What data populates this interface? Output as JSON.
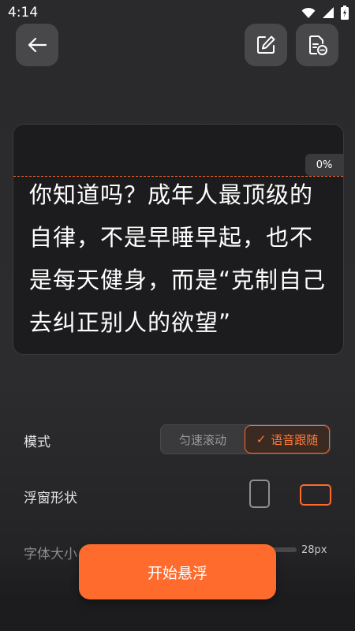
{
  "status_bar": {
    "time": "4:14"
  },
  "preview": {
    "scroll_percent": "0%",
    "script_text": "你知道吗？成年人最顶级的自律，不是早睡早起，也不是每天健身，而是“克制自己去纠正别人的欲望”"
  },
  "settings": {
    "mode_label": "模式",
    "mode_options": [
      "匀速滚动",
      "语音跟随"
    ],
    "mode_selected_index": 1,
    "shape_label": "浮窗形状",
    "shape_selected": "landscape",
    "font_size_label": "字体大小",
    "font_size_value": "28px",
    "font_size_fill_fraction": 0.01
  },
  "actions": {
    "start_label": "开始悬浮"
  },
  "colors": {
    "accent": "#ff6b2c",
    "background": "#2c2c2e",
    "card": "#1c1c1e"
  }
}
